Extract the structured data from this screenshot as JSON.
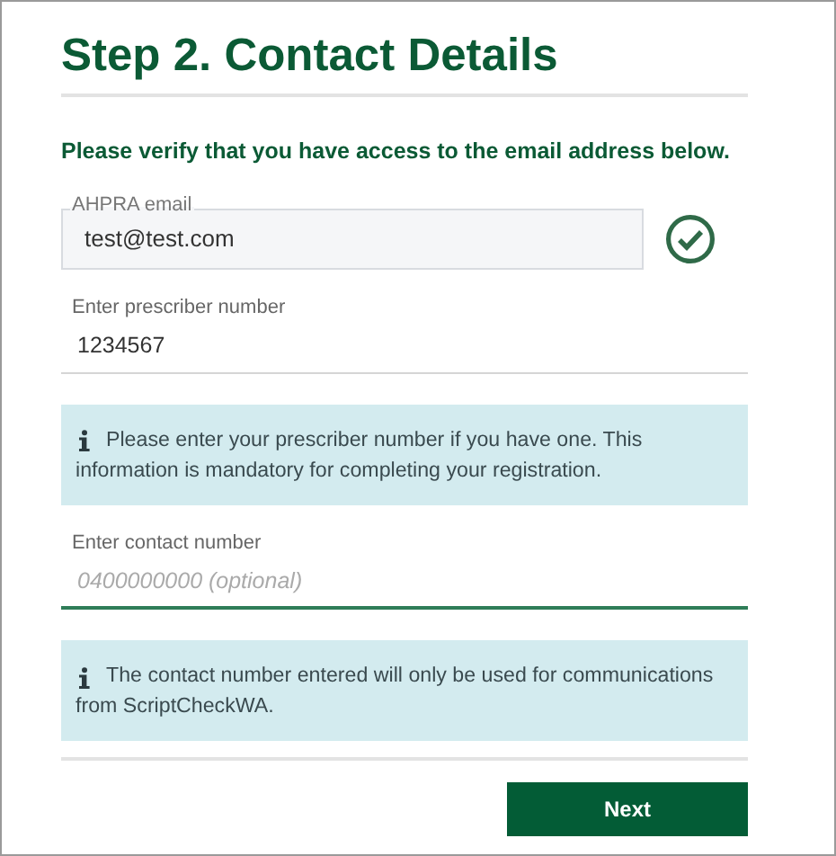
{
  "title": "Step 2. Contact Details",
  "instruction": "Please verify that you have access to the email address below.",
  "fields": [
    {
      "kind": "outlined",
      "label": "AHPRA email",
      "value": "test@test.com",
      "verified": true
    },
    {
      "kind": "underline",
      "label": "Enter prescriber number",
      "value": "1234567",
      "focused": false
    },
    {
      "kind": "info",
      "text": "Please enter your prescriber number if you have one. This information is mandatory for completing your registration."
    },
    {
      "kind": "underline",
      "label": "Enter contact number",
      "placeholder": "0400000000 (optional)",
      "focused": true
    },
    {
      "kind": "info",
      "text": "The contact number entered will only be used for communications from ScriptCheckWA."
    }
  ],
  "buttons": [
    {
      "label": "Next"
    }
  ]
}
